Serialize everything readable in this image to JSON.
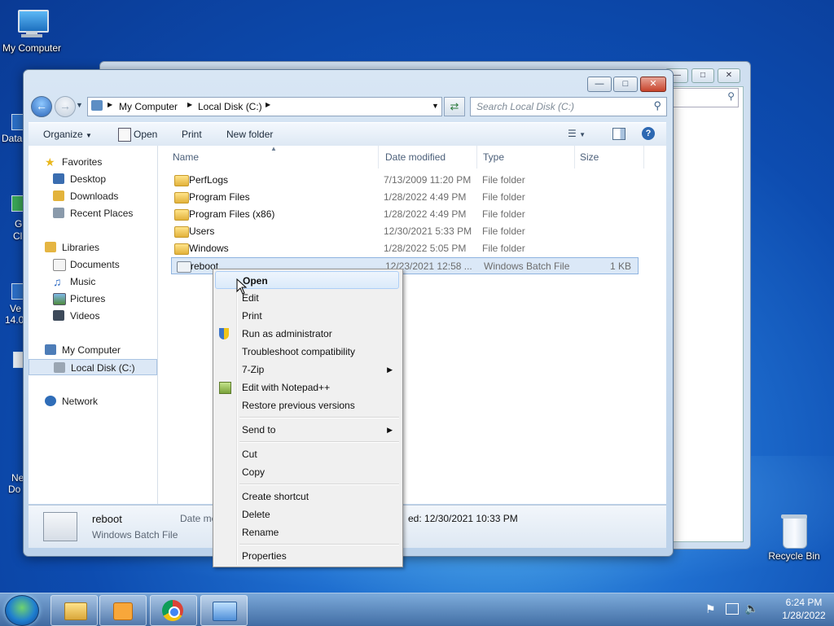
{
  "desktop": {
    "icons": [
      {
        "label": "My Computer"
      },
      {
        "label": "Recycle Bin"
      }
    ],
    "edge_labels": [
      "Data",
      "G",
      "Cl",
      "Ve",
      "14.0",
      "Ne",
      "Do"
    ]
  },
  "window": {
    "address": {
      "crumbs": [
        "My Computer",
        "Local Disk (C:)"
      ]
    },
    "search_placeholder": "Search Local Disk (C:)",
    "toolbar": {
      "organize": "Organize",
      "open": "Open",
      "print": "Print",
      "new_folder": "New folder"
    },
    "nav": {
      "favorites": "Favorites",
      "desktop": "Desktop",
      "downloads": "Downloads",
      "recent": "Recent Places",
      "libraries": "Libraries",
      "documents": "Documents",
      "music": "Music",
      "pictures": "Pictures",
      "videos": "Videos",
      "computer": "My Computer",
      "local_disk": "Local Disk (C:)",
      "network": "Network"
    },
    "columns": {
      "name": "Name",
      "date": "Date modified",
      "type": "Type",
      "size": "Size"
    },
    "files": [
      {
        "name": "PerfLogs",
        "date": "7/13/2009 11:20 PM",
        "type": "File folder",
        "size": ""
      },
      {
        "name": "Program Files",
        "date": "1/28/2022 4:49 PM",
        "type": "File folder",
        "size": ""
      },
      {
        "name": "Program Files (x86)",
        "date": "1/28/2022 4:49 PM",
        "type": "File folder",
        "size": ""
      },
      {
        "name": "Users",
        "date": "12/30/2021 5:33 PM",
        "type": "File folder",
        "size": ""
      },
      {
        "name": "Windows",
        "date": "1/28/2022 5:05 PM",
        "type": "File folder",
        "size": ""
      },
      {
        "name": "reboot",
        "date": "12/23/2021 12:58 ...",
        "type": "Windows Batch File",
        "size": "1 KB"
      }
    ],
    "details": {
      "name": "reboot",
      "type": "Windows Batch File",
      "date_label": "Date me",
      "date_value": "ed: 12/30/2021 10:33 PM"
    }
  },
  "context_menu": {
    "items": [
      {
        "label": "Open",
        "bold": true
      },
      {
        "label": "Edit"
      },
      {
        "label": "Print"
      },
      {
        "label": "Run as administrator"
      },
      {
        "label": "Troubleshoot compatibility"
      },
      {
        "label": "7-Zip"
      },
      {
        "label": "Edit with Notepad++"
      },
      {
        "label": "Restore previous versions"
      },
      {
        "label": "Send to"
      },
      {
        "label": "Cut"
      },
      {
        "label": "Copy"
      },
      {
        "label": "Create shortcut"
      },
      {
        "label": "Delete"
      },
      {
        "label": "Rename"
      },
      {
        "label": "Properties"
      }
    ]
  },
  "taskbar": {
    "time": "6:24 PM",
    "date": "1/28/2022"
  }
}
